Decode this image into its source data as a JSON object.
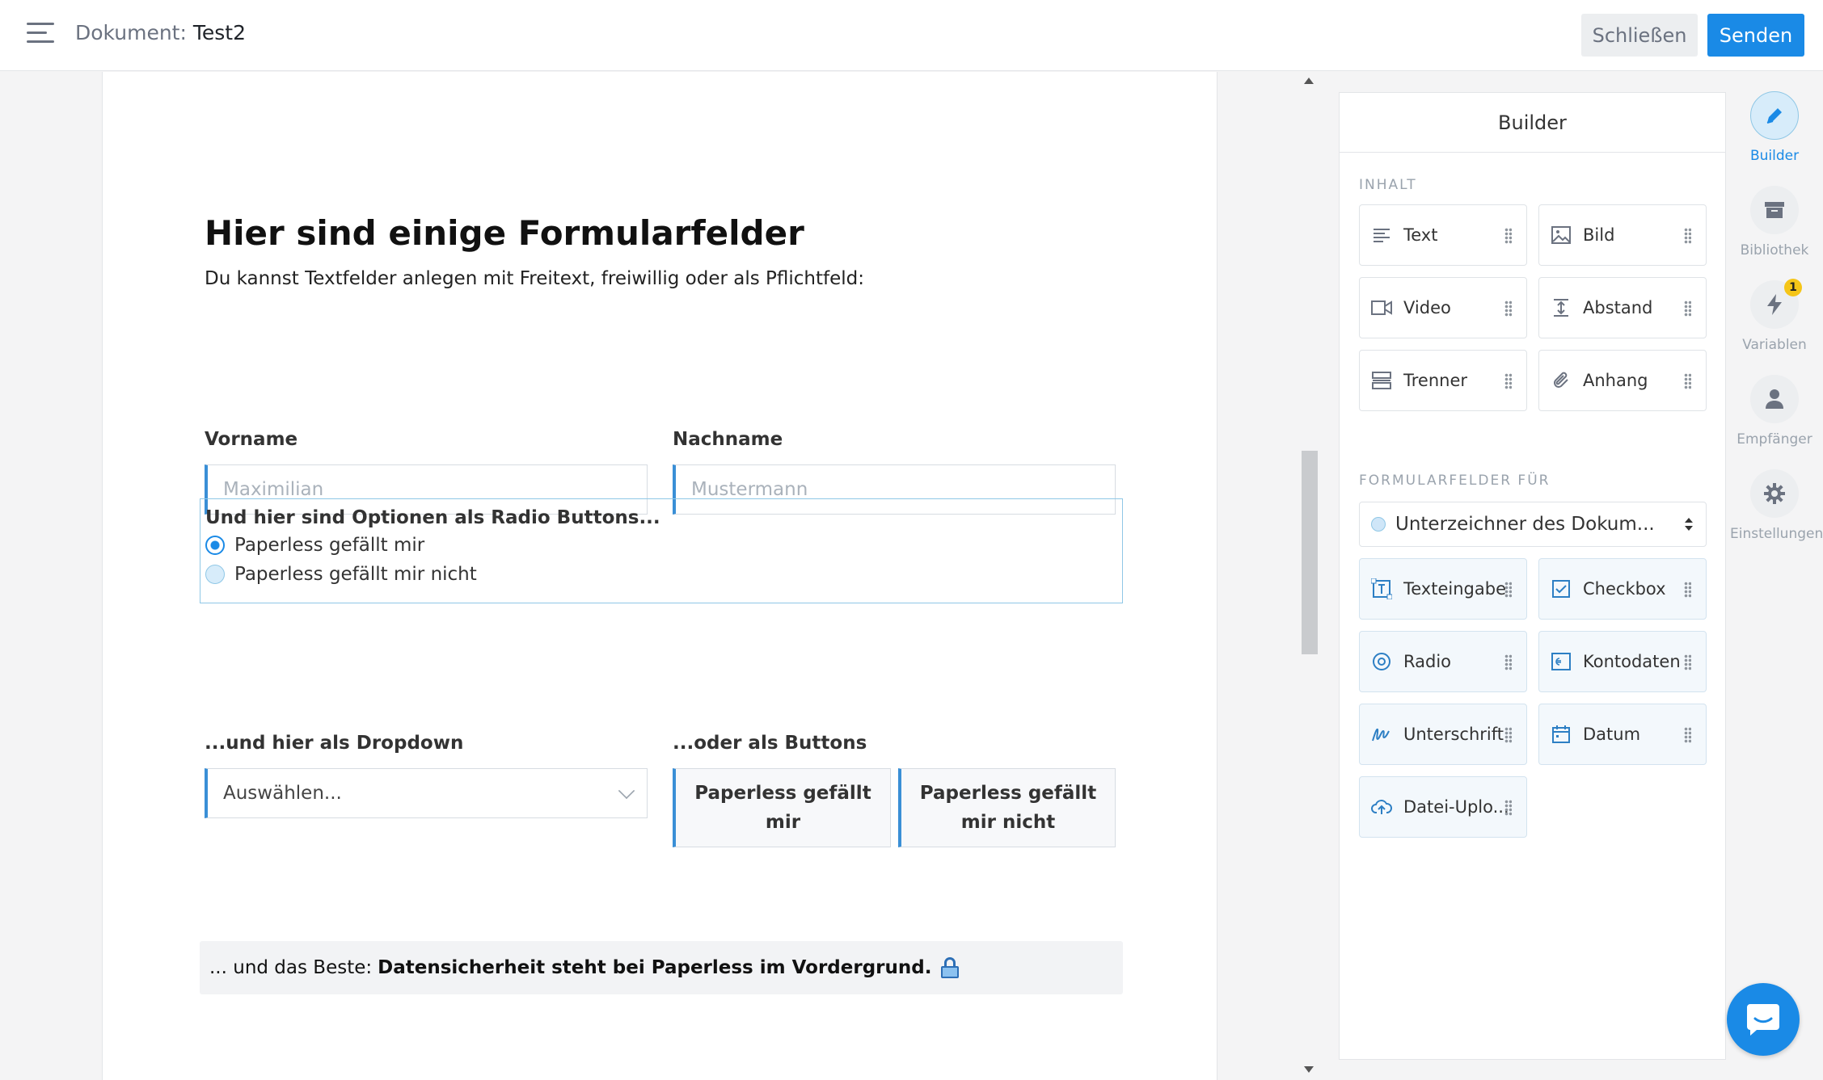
{
  "header": {
    "doc_label": "Dokument:",
    "doc_name": "Test2",
    "close_label": "Schließen",
    "send_label": "Senden"
  },
  "document": {
    "heading": "Hier sind einige Formularfelder",
    "subtext": "Du kannst Textfelder anlegen mit Freitext, freiwillig oder als Pflichtfeld:",
    "first_name": {
      "label": "Vorname",
      "placeholder": "Maximilian"
    },
    "last_name": {
      "label": "Nachname",
      "placeholder": "Mustermann"
    },
    "radio": {
      "title": "Und hier sind Optionen als Radio Buttons...",
      "options": [
        {
          "label": "Paperless gefällt mir",
          "selected": true
        },
        {
          "label": "Paperless gefällt mir nicht",
          "selected": false
        }
      ]
    },
    "dropdown": {
      "label": "...und hier als Dropdown",
      "value": "Auswählen..."
    },
    "buttons": {
      "label": "...oder als Buttons",
      "options": [
        "Paperless gefällt mir",
        "Paperless gefällt mir nicht"
      ]
    },
    "info": {
      "prefix": "... und das Beste:",
      "bold": "Datensicherheit steht bei Paperless im Vordergrund."
    }
  },
  "builder": {
    "title": "Builder",
    "content_section": "INHALT",
    "content_items": [
      "Text",
      "Bild",
      "Video",
      "Abstand",
      "Trenner",
      "Anhang"
    ],
    "form_section": "FORMULARFELDER FÜR",
    "signer": "Unterzeichner des Dokum...",
    "form_items": [
      "Texteingabe",
      "Checkbox",
      "Radio",
      "Kontodaten",
      "Unterschrift",
      "Datum",
      "Datei-Uplo..."
    ]
  },
  "rail": {
    "items": [
      {
        "label": "Builder",
        "active": true
      },
      {
        "label": "Bibliothek",
        "active": false
      },
      {
        "label": "Variablen",
        "active": false,
        "badge": "1"
      },
      {
        "label": "Empfänger",
        "active": false
      },
      {
        "label": "Einstellungen",
        "active": false
      }
    ]
  },
  "colors": {
    "accent": "#1a8ae6",
    "field_border": "#3a8fd6",
    "badge": "#f5c518"
  }
}
